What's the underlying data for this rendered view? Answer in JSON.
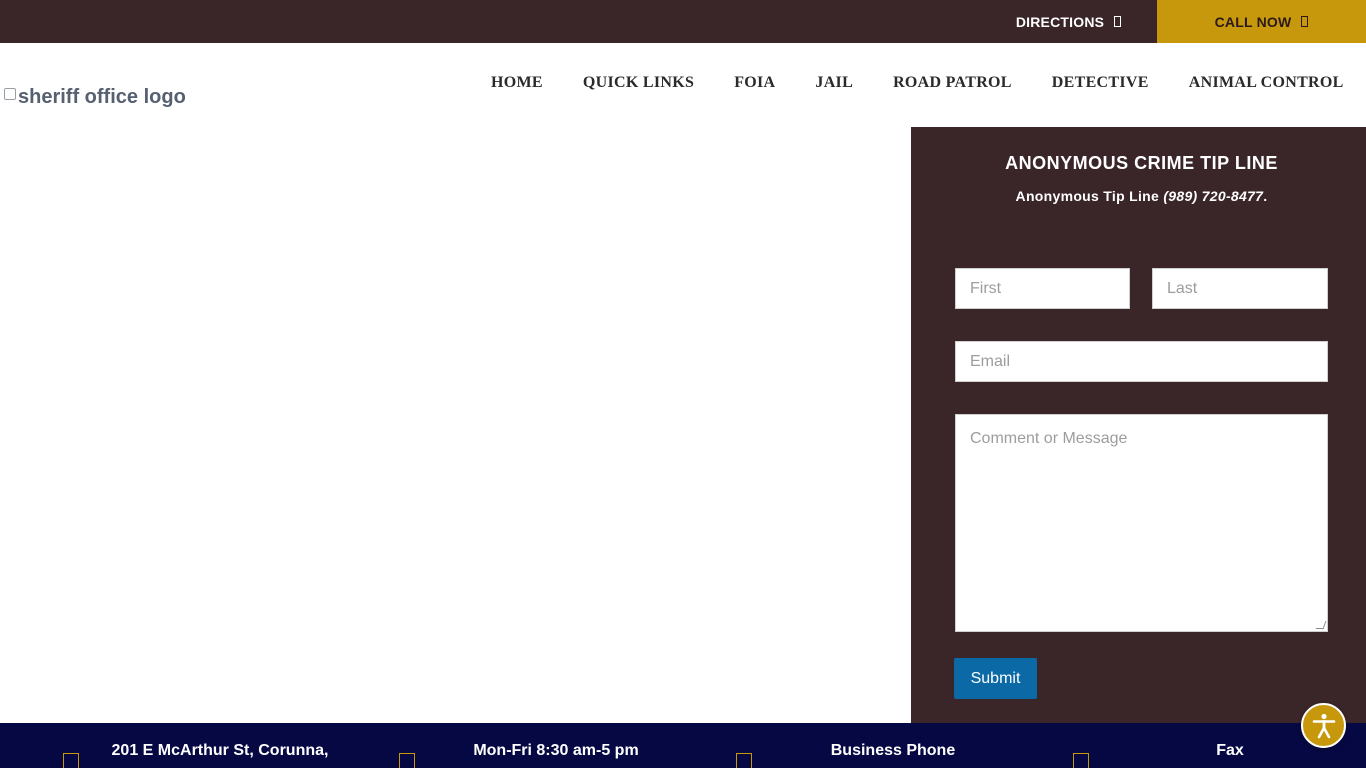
{
  "topbar": {
    "directions_label": "DIRECTIONS",
    "call_label": "CALL NOW",
    "bg_color": "#3a2529",
    "accent_color": "#c7980b"
  },
  "header": {
    "logo_alt": "sheriff office logo",
    "nav": [
      {
        "label": "HOME"
      },
      {
        "label": "QUICK LINKS"
      },
      {
        "label": "FOIA"
      },
      {
        "label": "JAIL"
      },
      {
        "label": "ROAD PATROL"
      },
      {
        "label": "DETECTIVE"
      },
      {
        "label": "ANIMAL CONTROL"
      }
    ]
  },
  "tip_panel": {
    "title": "ANONYMOUS CRIME TIP LINE",
    "line_text": "Anonymous Tip Line ",
    "line_phone": "(989) 720-8477",
    "line_suffix": ".",
    "form": {
      "first_placeholder": "First",
      "last_placeholder": "Last",
      "email_placeholder": "Email",
      "message_placeholder": "Comment or Message",
      "submit_label": "Submit"
    }
  },
  "footer": {
    "address": "201 E McArthur St, Corunna,",
    "hours": "Mon-Fri 8:30 am-5 pm",
    "business_phone_label": "Business Phone",
    "fax_label": "Fax"
  },
  "icons": {
    "directions": "external-link-icon",
    "call": "phone-icon",
    "accessibility": "accessibility-icon"
  }
}
